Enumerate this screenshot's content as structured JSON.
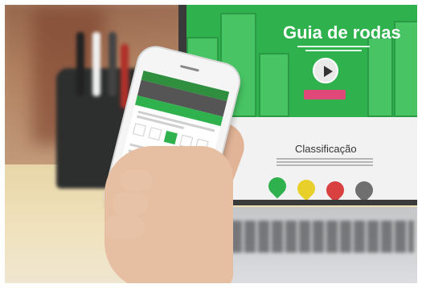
{
  "laptop": {
    "hero_title": "Guia de rodas",
    "section_title": "Classificação"
  },
  "colors": {
    "brand_green": "#2fb24d",
    "accent_pink": "#e0487a",
    "pin_green": "#2fb24d",
    "pin_yellow": "#e8cf2a",
    "pin_red": "#d94040",
    "pin_gray": "#6f6f6f"
  },
  "icons": {
    "play": "play-icon",
    "location_pins": [
      "location-pin-icon",
      "location-pin-icon",
      "location-pin-icon",
      "location-pin-icon"
    ]
  }
}
